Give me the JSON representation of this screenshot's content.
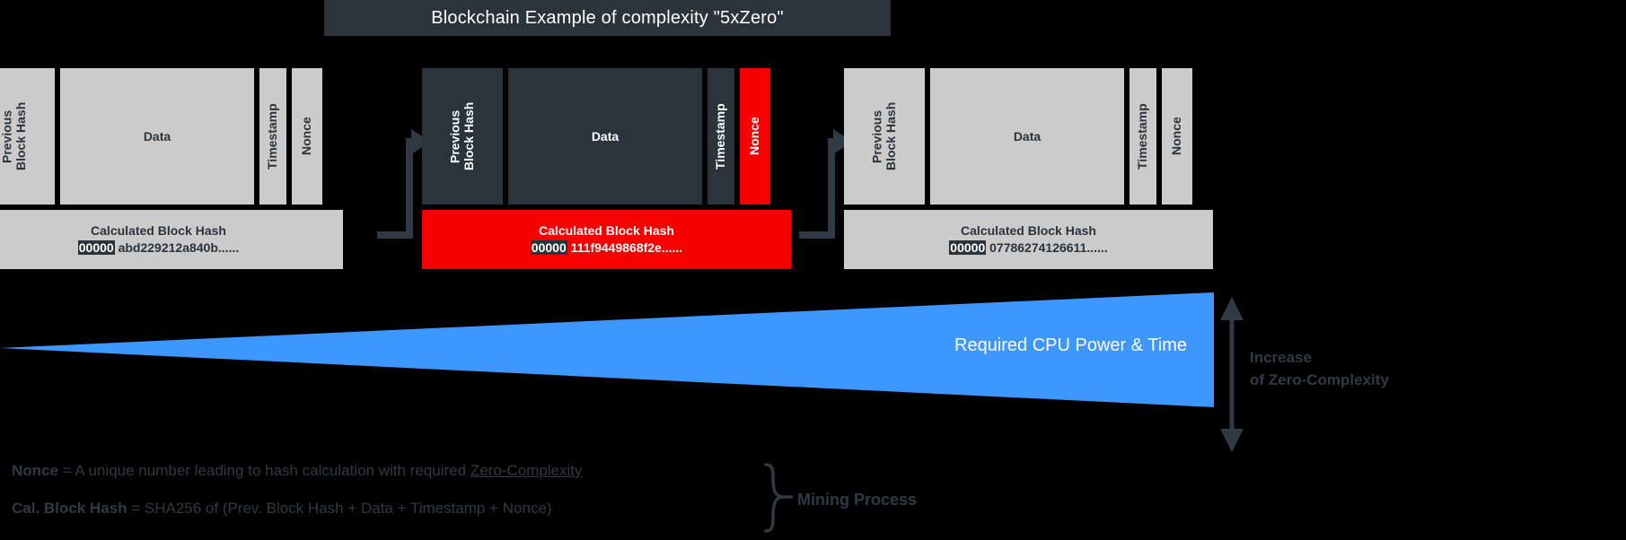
{
  "title": "Blockchain Example of complexity \"5xZero\"",
  "field_labels": {
    "prev_block_hash": "Previous\nBlock Hash",
    "data": "Data",
    "timestamp": "Timestamp",
    "nonce": "Nonce"
  },
  "hash_caption": "Calculated Block Hash",
  "blocks": [
    {
      "state": "confirmed",
      "prev_block_hash_label": "Previous\nBlock Hash",
      "data_label": "Data",
      "timestamp_label": "Timestamp",
      "nonce_label": "Nonce",
      "hash_caption": "Calculated Block Hash",
      "hash_zeros": "00000",
      "hash_rest": " abd229212a840b......"
    },
    {
      "state": "mining",
      "prev_block_hash_label": "Previous\nBlock Hash",
      "data_label": "Data",
      "timestamp_label": "Timestamp",
      "nonce_label": "Nonce",
      "hash_caption": "Calculated Block Hash",
      "hash_zeros": "00000",
      "hash_rest": " 111f9449868f2e......"
    },
    {
      "state": "confirmed",
      "prev_block_hash_label": "Previous\nBlock Hash",
      "data_label": "Data",
      "timestamp_label": "Timestamp",
      "nonce_label": "Nonce",
      "hash_caption": "Calculated Block Hash",
      "hash_zeros": "00000",
      "hash_rest": " 07786274126611......"
    }
  ],
  "wedge": {
    "label": "Required CPU Power & Time",
    "color": "#3d97ff"
  },
  "increase_axis": {
    "label": "Increase\nof Zero-Complexity"
  },
  "legend": {
    "line1_term": "Nonce",
    "line1_mid": " = A unique number leading to hash calculation with required ",
    "line1_underlined": "Zero-Complexity",
    "line2_term": "Cal. Block Hash",
    "line2_rest": " = SHA256 of (Prev. Block Hash + Data + Timestamp + Nonce)",
    "brace_label": "Mining Process"
  },
  "colors": {
    "background": "#000000",
    "block_fill": "#cbcbcb",
    "dark": "#2b333b",
    "alert_red": "#f80000",
    "accent_blue": "#3d97ff",
    "text_dark": "#2f3a44"
  }
}
